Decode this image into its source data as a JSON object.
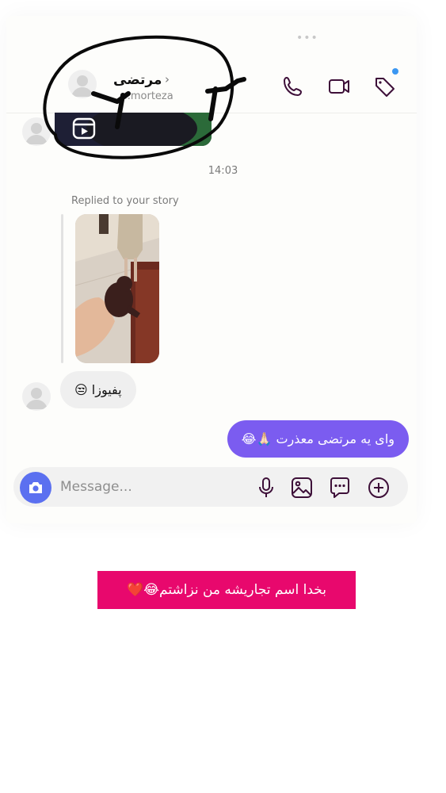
{
  "header": {
    "name": "مرتضی",
    "chevron": "›",
    "handle": "o.morteza",
    "menu_dots": "•••",
    "icons": [
      "phone-icon",
      "video-camera-icon",
      "tag-icon"
    ],
    "notification_dot_color": "#3b97f2"
  },
  "thread": {
    "timestamp": "14:03",
    "story_reply_label": "Replied to your story",
    "incoming_message": "پفیوزا 😒",
    "outgoing_message": "وای یه مرتضی معذرت 🙏🏻😂"
  },
  "composer": {
    "placeholder": "Message...",
    "icons": [
      "camera-icon",
      "microphone-icon",
      "gallery-icon",
      "sticker-icon",
      "add-icon"
    ]
  },
  "caption": {
    "text": "بخدا اسم تجاریشه من نزاشتم😂❤️",
    "background": "#e8086d"
  },
  "colors": {
    "accent": "#7b5cf0",
    "camera_button": "#5b70f0",
    "icon_stroke": "#3d0f38"
  }
}
